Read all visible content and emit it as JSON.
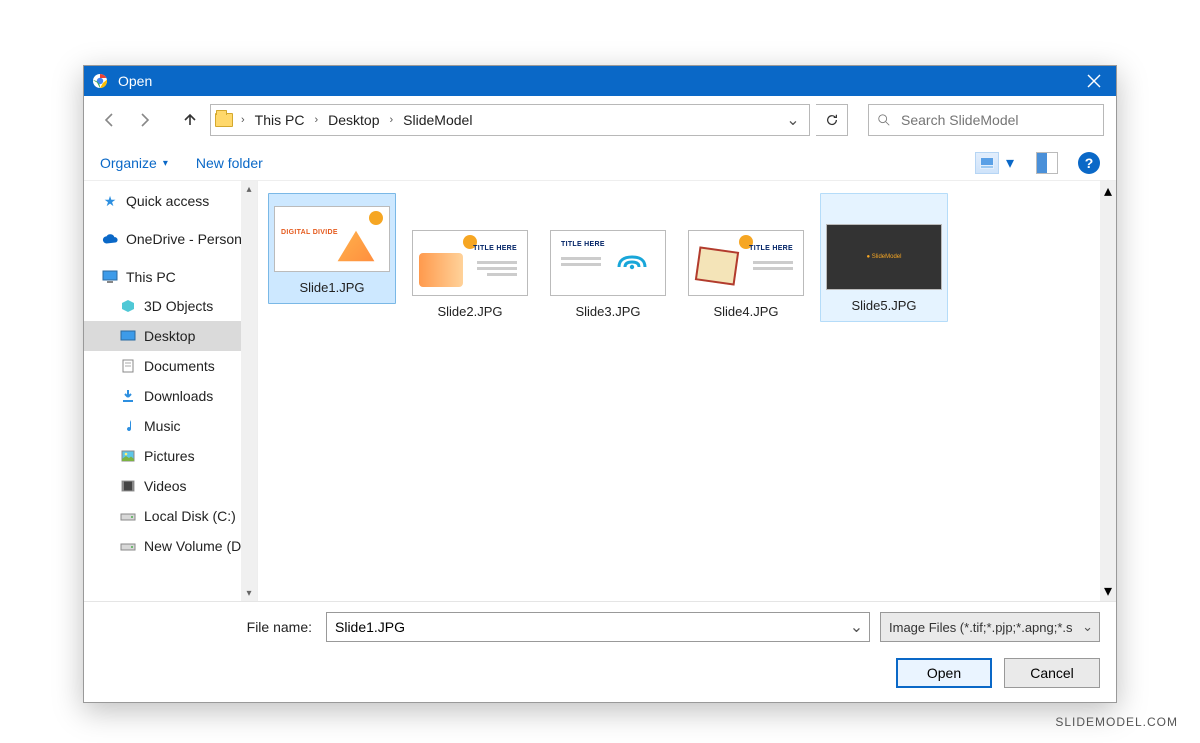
{
  "titlebar": {
    "title": "Open"
  },
  "breadcrumbs": [
    "This PC",
    "Desktop",
    "SlideModel"
  ],
  "search": {
    "placeholder": "Search SlideModel"
  },
  "toolbar": {
    "organize": "Organize",
    "newfolder": "New folder"
  },
  "nav": {
    "quick_access": "Quick access",
    "onedrive": "OneDrive - Person",
    "this_pc": "This PC",
    "items": [
      "3D Objects",
      "Desktop",
      "Documents",
      "Downloads",
      "Music",
      "Pictures",
      "Videos",
      "Local Disk (C:)",
      "New Volume (D:"
    ]
  },
  "files": [
    {
      "name": "Slide1.JPG",
      "selected": true
    },
    {
      "name": "Slide2.JPG",
      "selected": false
    },
    {
      "name": "Slide3.JPG",
      "selected": false
    },
    {
      "name": "Slide4.JPG",
      "selected": false
    },
    {
      "name": "Slide5.JPG",
      "selected": false,
      "hover": true,
      "dark": true
    }
  ],
  "file_thumbs": {
    "t1_text": "DIGITAL DIVIDE",
    "t_generic": "TITLE HERE"
  },
  "filename": {
    "label": "File name:",
    "value": "Slide1.JPG"
  },
  "filter": {
    "text": "Image Files (*.tif;*.pjp;*.apng;*.s"
  },
  "buttons": {
    "open": "Open",
    "cancel": "Cancel"
  },
  "watermark": "SLIDEMODEL.COM"
}
